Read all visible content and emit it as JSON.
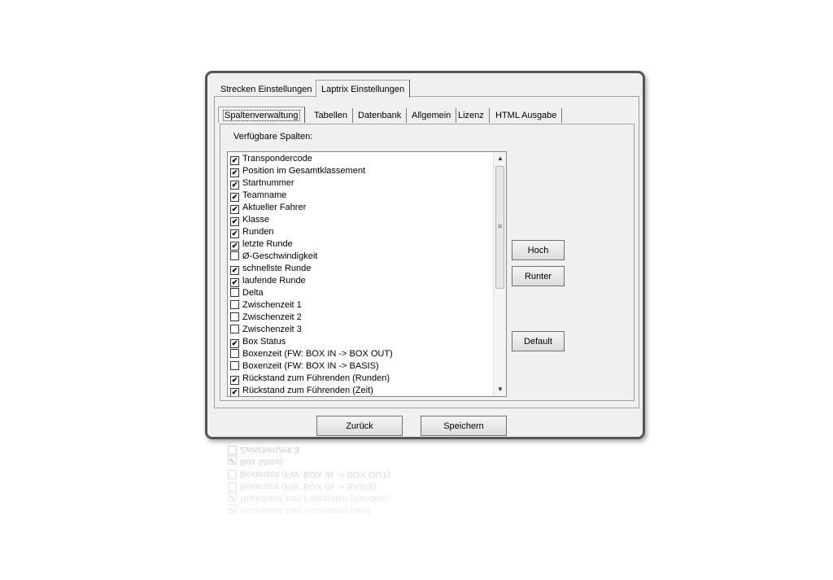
{
  "outer_tabs": [
    {
      "label": "Strecken Einstellungen",
      "active": false
    },
    {
      "label": "Laptrix Einstellungen",
      "active": true
    }
  ],
  "inner_tabs": [
    {
      "label": "Spaltenverwaltung",
      "active": true
    },
    {
      "label": "Tabellen",
      "active": false
    },
    {
      "label": "Datenbank",
      "active": false
    },
    {
      "label": "Allgemein",
      "active": false
    },
    {
      "label": "Lizenz",
      "active": false
    },
    {
      "label": "HTML Ausgabe",
      "active": false
    }
  ],
  "columns_label": "Verfügbare Spalten:",
  "columns": [
    {
      "label": "Transpondercode",
      "checked": true
    },
    {
      "label": "Position im Gesamtklassement",
      "checked": true
    },
    {
      "label": "Startnummer",
      "checked": true
    },
    {
      "label": "Teamname",
      "checked": true
    },
    {
      "label": "Aktueller Fahrer",
      "checked": true
    },
    {
      "label": "Klasse",
      "checked": true
    },
    {
      "label": "Runden",
      "checked": true
    },
    {
      "label": "letzte Runde",
      "checked": true
    },
    {
      "label": "Ø-Geschwindigkeit",
      "checked": false
    },
    {
      "label": "schnellste Runde",
      "checked": true
    },
    {
      "label": "laufende Runde",
      "checked": true
    },
    {
      "label": "Delta",
      "checked": false
    },
    {
      "label": "Zwischenzeit 1",
      "checked": false
    },
    {
      "label": "Zwischenzeit 2",
      "checked": false
    },
    {
      "label": "Zwischenzeit 3",
      "checked": false
    },
    {
      "label": "Box Status",
      "checked": true
    },
    {
      "label": "Boxenzeit (FW: BOX IN -> BOX OUT)",
      "checked": false
    },
    {
      "label": "Boxenzeit (FW: BOX IN -> BASIS)",
      "checked": false
    },
    {
      "label": "Rückstand zum Führenden (Runden)",
      "checked": true
    },
    {
      "label": "Rückstand zum Führenden (Zeit)",
      "checked": true
    }
  ],
  "buttons": {
    "up": "Hoch",
    "down": "Runter",
    "default": "Default",
    "back": "Zurück",
    "save": "Speichern"
  },
  "icons": {
    "scroll_up": "scroll-up-arrow-icon",
    "scroll_down": "scroll-down-arrow-icon",
    "checkmark": "checkmark-icon"
  },
  "colors": {
    "window_bg": "#f0f0f0",
    "frame": "#555555",
    "list_bg": "#ffffff"
  }
}
